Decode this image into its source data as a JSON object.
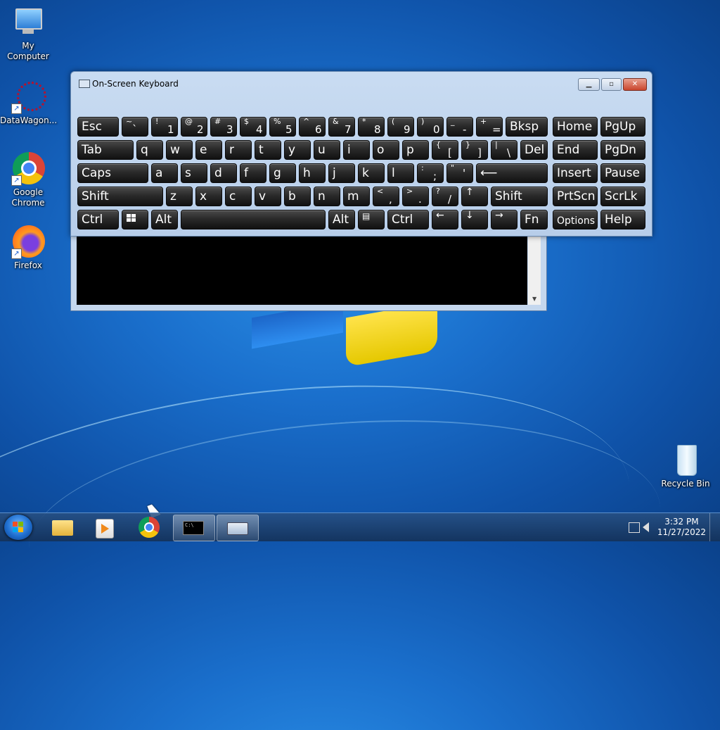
{
  "desktop": {
    "icons": [
      {
        "label": "My Computer"
      },
      {
        "label": "DataWagon..."
      },
      {
        "label": "Google Chrome"
      },
      {
        "label": "Firefox"
      },
      {
        "label": "Recycle Bin"
      }
    ]
  },
  "osk": {
    "title": "On-Screen Keyboard",
    "keys": {
      "esc": "Esc",
      "tilde_up": "~",
      "tilde_lo": "`",
      "k1_up": "!",
      "k1": "1",
      "k2_up": "@",
      "k2": "2",
      "k3_up": "#",
      "k3": "3",
      "k4_up": "$",
      "k4": "4",
      "k5_up": "%",
      "k5": "5",
      "k6_up": "^",
      "k6": "6",
      "k7_up": "&",
      "k7": "7",
      "k8_up": "*",
      "k8": "8",
      "k9_up": "(",
      "k9": "9",
      "k0_up": ")",
      "k0": "0",
      "minus_up": "_",
      "minus": "-",
      "eq_up": "+",
      "eq": "=",
      "bksp": "Bksp",
      "home": "Home",
      "pgup": "PgUp",
      "tab": "Tab",
      "q": "q",
      "w": "w",
      "e": "e",
      "r": "r",
      "t": "t",
      "y": "y",
      "u": "u",
      "i": "i",
      "o": "o",
      "p": "p",
      "lbr_up": "{",
      "lbr": "[",
      "rbr_up": "}",
      "rbr": "]",
      "bs_up": "|",
      "bs": "\\",
      "del": "Del",
      "end": "End",
      "pgdn": "PgDn",
      "caps": "Caps",
      "a": "a",
      "s": "s",
      "d": "d",
      "f": "f",
      "g": "g",
      "h": "h",
      "j": "j",
      "k": "k",
      "l": "l",
      "semi_up": ":",
      "semi": ";",
      "quote_up": "\"",
      "quote": "'",
      "enter": "⟵",
      "insert": "Insert",
      "pause": "Pause",
      "shift": "Shift",
      "z": "z",
      "x": "x",
      "c": "c",
      "v": "v",
      "b": "b",
      "n": "n",
      "m": "m",
      "comma_up": "<",
      "comma": ",",
      "period_up": ">",
      "period": ".",
      "slash_up": "?",
      "slash": "/",
      "up": "↑",
      "rshift": "Shift",
      "prtscn": "PrtScn",
      "scrlk": "ScrLk",
      "ctrl": "Ctrl",
      "alt": "Alt",
      "ralt": "Alt",
      "menu": "▤",
      "rctrl": "Ctrl",
      "left": "←",
      "down": "↓",
      "right": "→",
      "fn": "Fn",
      "options": "Options",
      "help": "Help"
    }
  },
  "taskbar": {
    "clock_time": "3:32 PM",
    "clock_date": "11/27/2022"
  }
}
